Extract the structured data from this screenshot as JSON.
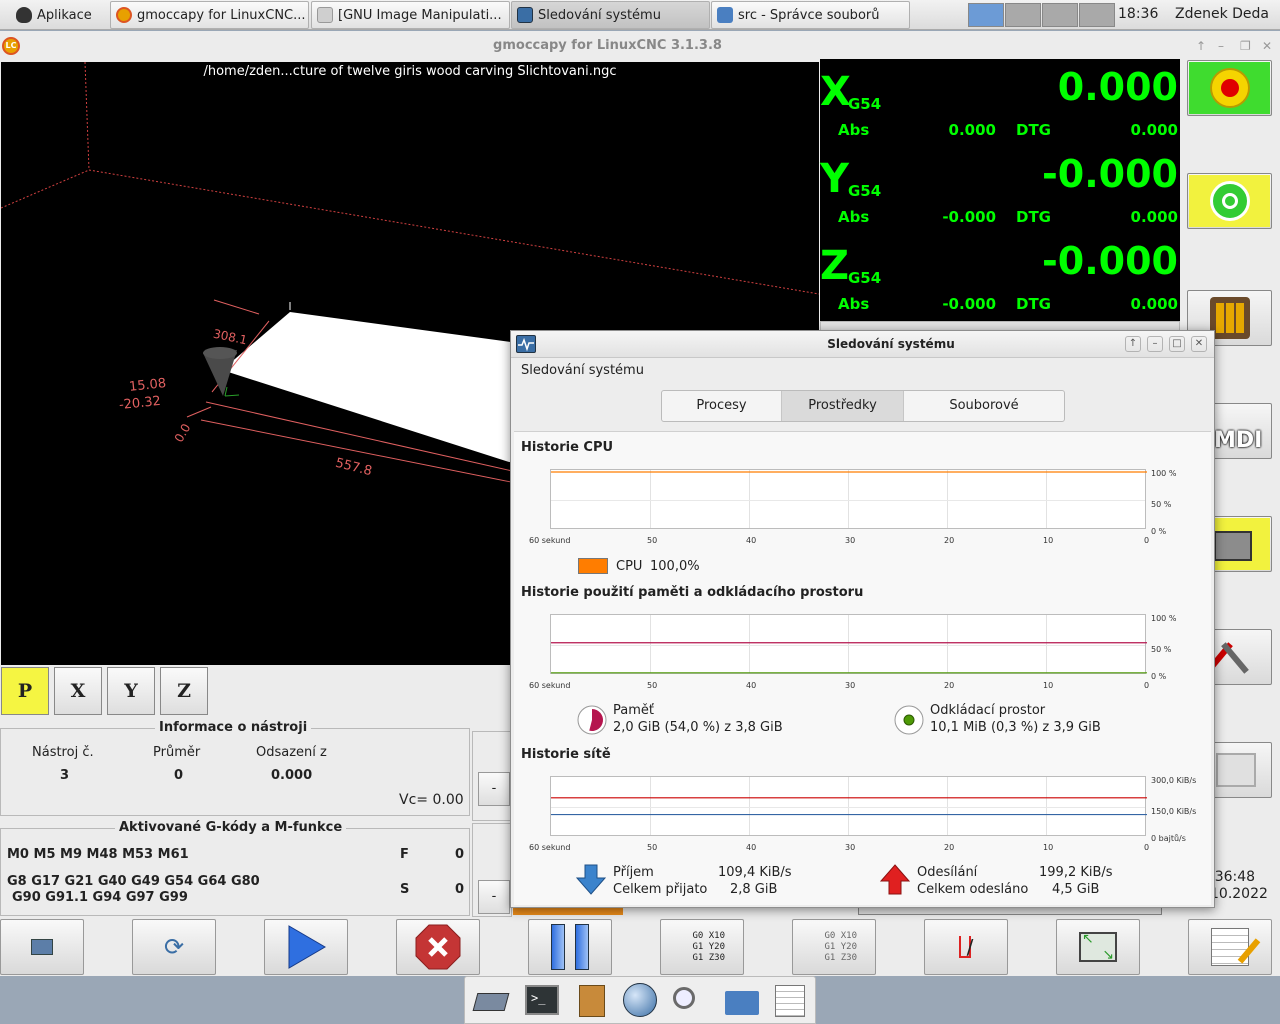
{
  "taskbar": {
    "apps_label": "Aplikace",
    "windows": [
      {
        "title": "gmoccapy for LinuxCNC...",
        "icon": "linuxcnc-icon"
      },
      {
        "title": "[GNU Image Manipulati...",
        "icon": "gimp-icon"
      },
      {
        "title": "Sledování systému",
        "icon": "system-monitor-icon"
      },
      {
        "title": "src - Správce souborů",
        "icon": "folder-icon"
      }
    ],
    "clock": "18:36",
    "user": "Zdenek Deda"
  },
  "gmoccapy": {
    "title": "gmoccapy for LinuxCNC  3.1.3.8",
    "file": "/home/zden...cture of twelve giris wood carving Slichtovani.ngc",
    "dims": {
      "d1": "308.1",
      "d2": "15.08",
      "d3": "-20.32",
      "d4": "0.0",
      "d5": "557.8"
    },
    "dro": [
      {
        "axis": "X",
        "coord": "G54",
        "value": "0.000",
        "abs_label": "Abs",
        "abs": "0.000",
        "dtg_label": "DTG",
        "dtg": "0.000"
      },
      {
        "axis": "Y",
        "coord": "G54",
        "value": "-0.000",
        "abs_label": "Abs",
        "abs": "-0.000",
        "dtg_label": "DTG",
        "dtg": "0.000"
      },
      {
        "axis": "Z",
        "coord": "G54",
        "value": "-0.000",
        "abs_label": "Abs",
        "abs": "-0.000",
        "dtg_label": "DTG",
        "dtg": "0.000"
      }
    ],
    "view_buttons": [
      "P",
      "X",
      "Y",
      "Z"
    ],
    "tool_info": {
      "title": "Informace o nástroji",
      "tool_label": "Nástroj č.",
      "tool": "3",
      "diameter_label": "Průměr",
      "diameter": "0",
      "offset_label": "Odsazení z",
      "offset": "0.000",
      "vc": "Vc= 0.00"
    },
    "gcodes": {
      "title": "Aktivované G-kódy a M-funkce",
      "mcodes": "M0 M5 M9 M48 M53 M61",
      "gline1": "G8 G17 G21 G40 G49 G54 G64 G80",
      "gline2": "G90 G91.1 G94 G97 G99",
      "f_label": "F",
      "f": "0",
      "s_label": "S",
      "s": "0"
    },
    "minus": "-",
    "side_label_mdi": "MDI",
    "partial_time": ":36:48",
    "partial_date": "10.2022",
    "bottom_buttons": {
      "gcode_block1": [
        "G0",
        "X10",
        "G1",
        "Y20",
        "G1",
        "Z30"
      ],
      "gcode_block2": [
        "G0",
        "X10",
        "G1",
        "Y20",
        "G1",
        "Z30"
      ],
      "skip_glyph": "/"
    }
  },
  "sysmon": {
    "title": "Sledování systému",
    "subtitle": "Sledování systému",
    "tabs": [
      "Procesy",
      "Prostředky",
      "Souborové systémy"
    ],
    "cpu": {
      "heading": "Historie CPU",
      "y_labels": [
        "100 %",
        "50 %",
        "0 %"
      ],
      "legend": "CPU",
      "value": "100,0%",
      "color": "#ff7d00",
      "usage_fraction": 1.0
    },
    "memory": {
      "heading": "Historie použití paměti a odkládacího prostoru",
      "y_labels": [
        "100 %",
        "50 %",
        "0 %"
      ],
      "mem_label": "Paměť",
      "mem_detail": "2,0 GiB (54,0 %) z 3,8 GiB",
      "mem_color": "#b5154e",
      "mem_fraction": 0.54,
      "swap_label": "Odkládací prostor",
      "swap_detail": "10,1 MiB (0,3 %) z 3,9 GiB",
      "swap_color": "#4e9a06",
      "swap_fraction": 0.003
    },
    "network": {
      "heading": "Historie sítě",
      "y_labels": [
        "300,0 KiB/s",
        "150,0 KiB/s",
        "0 bajtů/s"
      ],
      "rx_label": "Příjem",
      "rx_rate": "109,4 KiB/s",
      "rx_total_label": "Celkem přijato",
      "rx_total": "2,8 GiB",
      "tx_label": "Odesílání",
      "tx_rate": "199,2 KiB/s",
      "tx_total_label": "Celkem odesláno",
      "tx_total": "4,5 GiB",
      "rx_color": "#3465a4",
      "tx_color": "#cc0000"
    },
    "x_labels": [
      "60 sekund",
      "50",
      "40",
      "30",
      "20",
      "10",
      "0"
    ]
  }
}
